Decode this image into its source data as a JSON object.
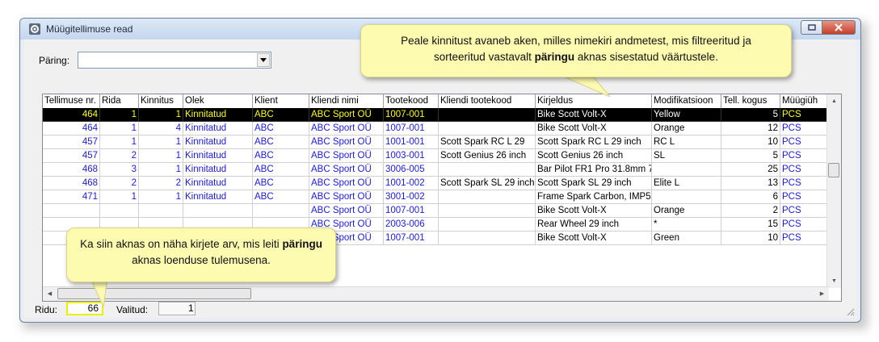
{
  "window": {
    "title": "Müügitellimuse read"
  },
  "query": {
    "label": "Päring:",
    "value": ""
  },
  "columns": [
    "Tellimuse nr.",
    "Rida",
    "Kinnitus",
    "Olek",
    "Klient",
    "Kliendi nimi",
    "Tootekood",
    "Kliendi tootekood",
    "Kirjeldus",
    "Modifikatsioon",
    "Tell. kogus",
    "Müügiüh"
  ],
  "rows": [
    [
      "464",
      "1",
      "1",
      "Kinnitatud",
      "ABC",
      "ABC Sport OÜ",
      "1007-001",
      "",
      "Bike Scott Volt-X",
      "Yellow",
      "5",
      "PCS"
    ],
    [
      "464",
      "1",
      "4",
      "Kinnitatud",
      "ABC",
      "ABC Sport OÜ",
      "1007-001",
      "",
      "Bike Scott Volt-X",
      "Orange",
      "12",
      "PCS"
    ],
    [
      "457",
      "1",
      "1",
      "Kinnitatud",
      "ABC",
      "ABC Sport OÜ",
      "1001-001",
      "Scott Spark RC L 29",
      "Scott Spark RC L 29 inch",
      "RC L",
      "10",
      "PCS"
    ],
    [
      "457",
      "2",
      "1",
      "Kinnitatud",
      "ABC",
      "ABC Sport OÜ",
      "1003-001",
      "Scott Genius 26 inch",
      "Scott Genius 26 inch",
      "SL",
      "5",
      "PCS"
    ],
    [
      "468",
      "3",
      "1",
      "Kinnitatud",
      "ABC",
      "ABC Sport OÜ",
      "3006-005",
      "",
      "Bar Pilot FR1 Pro 31.8mm 7",
      "",
      "25",
      "PCS"
    ],
    [
      "468",
      "2",
      "2",
      "Kinnitatud",
      "ABC",
      "ABC Sport OÜ",
      "1001-002",
      "Scott Spark SL 29 inch",
      "Scott Spark SL 29 inch",
      "Elite L",
      "13",
      "PCS"
    ],
    [
      "471",
      "1",
      "1",
      "Kinnitatud",
      "ABC",
      "ABC Sport OÜ",
      "3001-002",
      "",
      "Frame Spark Carbon, IMP5",
      "",
      "6",
      "PCS"
    ],
    [
      "",
      "",
      "",
      "",
      "",
      "ABC Sport OÜ",
      "1007-001",
      "",
      "Bike Scott Volt-X",
      "Orange",
      "2",
      "PCS"
    ],
    [
      "",
      "",
      "",
      "",
      "",
      "ABC Sport OÜ",
      "2003-006",
      "",
      "Rear Wheel 29 inch",
      "*",
      "15",
      "PCS"
    ],
    [
      "",
      "",
      "",
      "",
      "",
      "ABC Sport OÜ",
      "1007-001",
      "",
      "Bike Scott Volt-X",
      "Green",
      "10",
      "PCS"
    ]
  ],
  "status": {
    "ridu_label": "Ridu:",
    "ridu_value": "66",
    "valitud_label": "Valitud:",
    "valitud_value": "1"
  },
  "callouts": {
    "top": {
      "before": "Peale kinnitust avaneb aken, milles nimekiri andmetest, mis filtreeritud ja sorteeritud vastavalt ",
      "bold": "päringu",
      "after": " aknas sisestatud väärtustele."
    },
    "bottom": {
      "before": "Ka siin aknas on näha kirjete arv, mis leiti ",
      "bold": "päringu",
      "after": " aknas loenduse tulemusena."
    }
  }
}
